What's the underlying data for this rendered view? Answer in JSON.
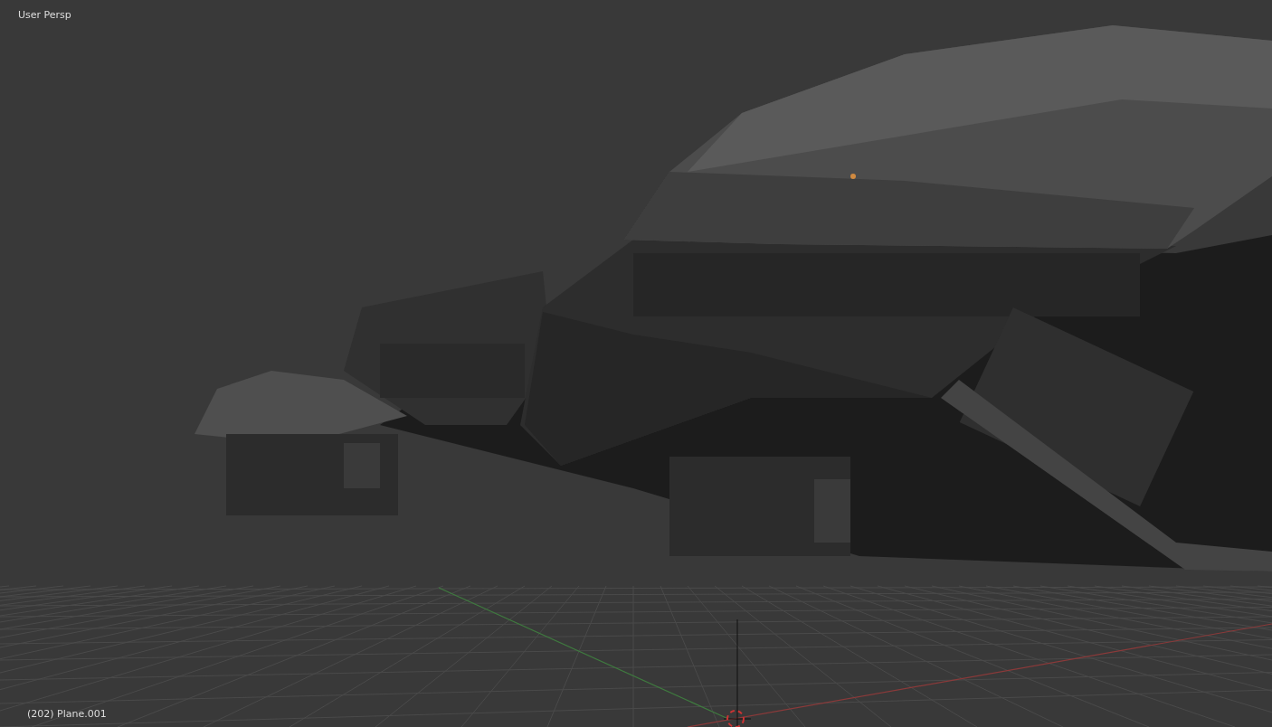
{
  "viewport": {
    "view_label": "User Persp",
    "object_label": "(202) Plane.001"
  }
}
